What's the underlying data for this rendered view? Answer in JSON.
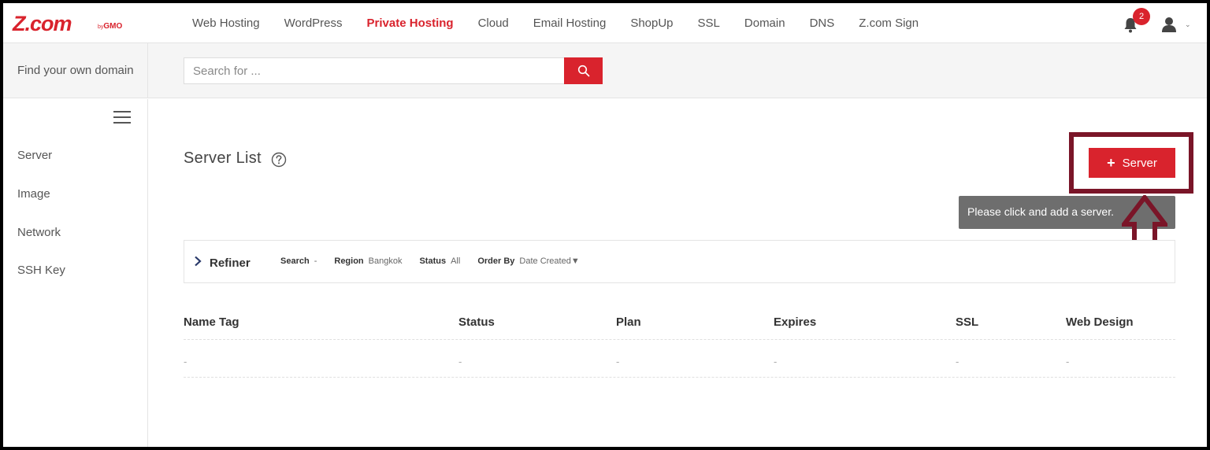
{
  "brand": {
    "logo_text": "Z.com",
    "logo_by": "by",
    "logo_sub": "GMO"
  },
  "nav": {
    "links": [
      "Web Hosting",
      "WordPress",
      "Private Hosting",
      "Cloud",
      "Email Hosting",
      "ShopUp",
      "SSL",
      "Domain",
      "DNS",
      "Z.com Sign"
    ],
    "active": "Private Hosting",
    "notification_count": "2",
    "user_caret": "⌄"
  },
  "search": {
    "label": "Find your own domain",
    "placeholder": "Search for ..."
  },
  "sidebar": {
    "items": [
      "Server",
      "Image",
      "Network",
      "SSH Key"
    ]
  },
  "main": {
    "title": "Server List",
    "add_button_plus": "+",
    "add_button_label": "Server",
    "tooltip": "Please click and add a server."
  },
  "refiner": {
    "title": "Refiner",
    "filters": [
      {
        "key": "Search",
        "value": "-"
      },
      {
        "key": "Region",
        "value": "Bangkok"
      },
      {
        "key": "Status",
        "value": "All"
      },
      {
        "key": "Order By",
        "value": "Date Created▼"
      }
    ]
  },
  "table": {
    "columns": [
      "Name Tag",
      "Status",
      "Plan",
      "Expires",
      "SSL",
      "Web Design"
    ],
    "rows": [
      [
        "-",
        "-",
        "-",
        "-",
        "-",
        "-"
      ]
    ]
  },
  "colors": {
    "brand_red": "#d9232d",
    "highlight": "#7a1528",
    "tooltip_bg": "#6e6e6e"
  }
}
